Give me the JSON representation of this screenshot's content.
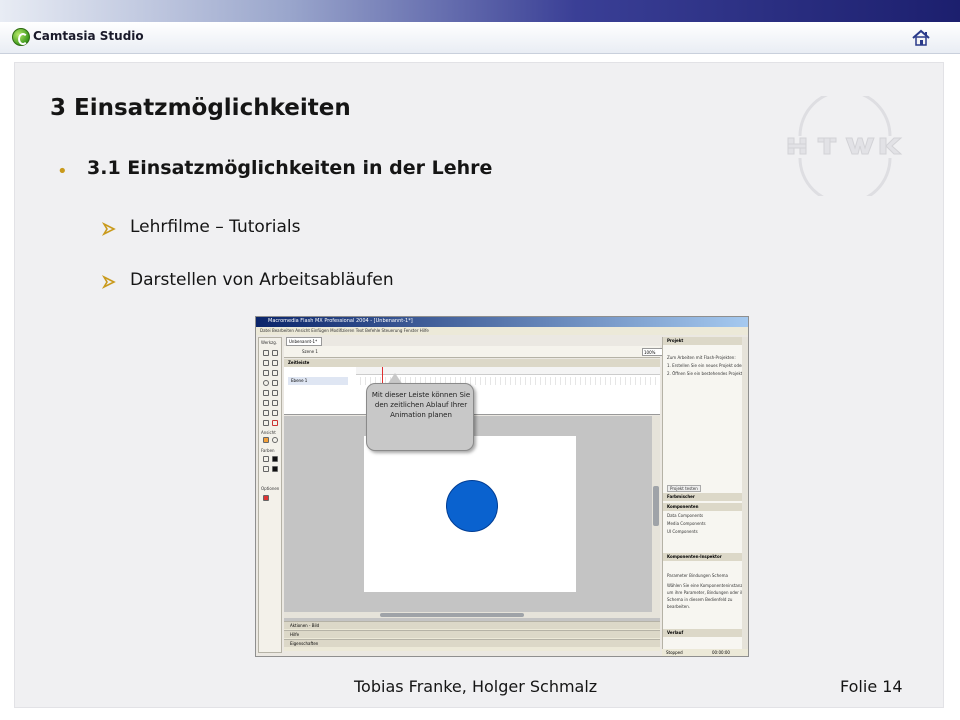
{
  "app": {
    "title": "Camtasia Studio"
  },
  "slide": {
    "title": "3 Einsatzmöglichkeiten",
    "section": "3.1 Einsatzmöglichkeiten in der Lehre",
    "items": [
      {
        "label": "Lehrfilme – Tutorials"
      },
      {
        "label": "Darstellen von Arbeitsabläufen"
      }
    ],
    "footer": {
      "authors": "Tobias Franke, Holger Schmalz",
      "page": "Folie 14"
    }
  },
  "screenshot": {
    "window_title": "Macromedia Flash MX Professional 2004 - [Unbenannt-1*]",
    "menu": "Datei  Bearbeiten  Ansicht  Einfügen  Modifizieren  Text  Befehle  Steuerung  Fenster  Hilfe",
    "doc_tab": "Unbenannt-1*",
    "scene": "Szene 1",
    "zoom": "100%",
    "timeline_header": "Zeitleiste",
    "layer_name": "Ebene 1",
    "callout": "Mit dieser Leiste können Sie den zeitlichen Ablauf Ihrer Animation planen",
    "tools": {
      "title": "Werkzg.",
      "view": "Ansicht",
      "colors": "Farben",
      "options": "Optionen"
    },
    "bottom_panels": [
      "Aktionen - Bild",
      "Hilfe",
      "Eigenschaften"
    ],
    "right": {
      "project": "Projekt",
      "project_lines": [
        "Zum Arbeiten mit Flash-Projekten:",
        "1. Erstellen Sie ein neues Projekt oder",
        "2. Öffnen Sie ein bestehendes Projekt"
      ],
      "project_button": "Projekt testen",
      "color_mixer": "Farbmischer",
      "components": "Komponenten",
      "component_items": [
        "Data Components",
        "Media Components",
        "UI Components"
      ],
      "inspector": "Komponenten-Inspektor",
      "inspector_tabs": "Parameter  Bindungen  Schema",
      "inspector_lines": [
        "Wählen Sie eine Komponenteninstanz",
        "um ihre Parameter, Bindungen oder ihr",
        "Schema in diesem Bedienfeld zu",
        "bearbeiten."
      ],
      "history": "Verlauf"
    },
    "status": "Stopped",
    "timecode": "00:00:00"
  },
  "colors": {
    "circle": "#0a62cf",
    "bullet": "#c99a1c",
    "arrow": "#c99a1c",
    "banner": "#1c1f6e"
  }
}
